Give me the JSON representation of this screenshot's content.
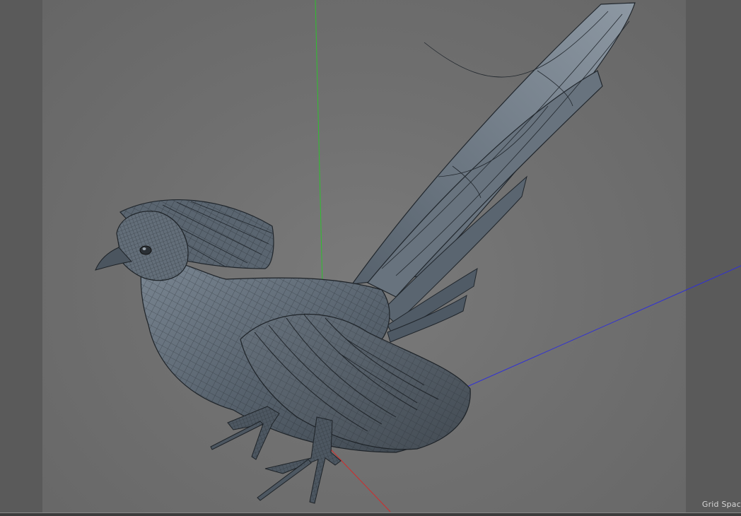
{
  "viewport": {
    "grid_label": "Grid Spac",
    "axis_colors": {
      "x": "#d22b2b",
      "y": "#2ec02e",
      "z": "#2f2fd8"
    },
    "background_color": "#707070",
    "model_color": "#55606b",
    "wire_color": "#1d2126"
  }
}
